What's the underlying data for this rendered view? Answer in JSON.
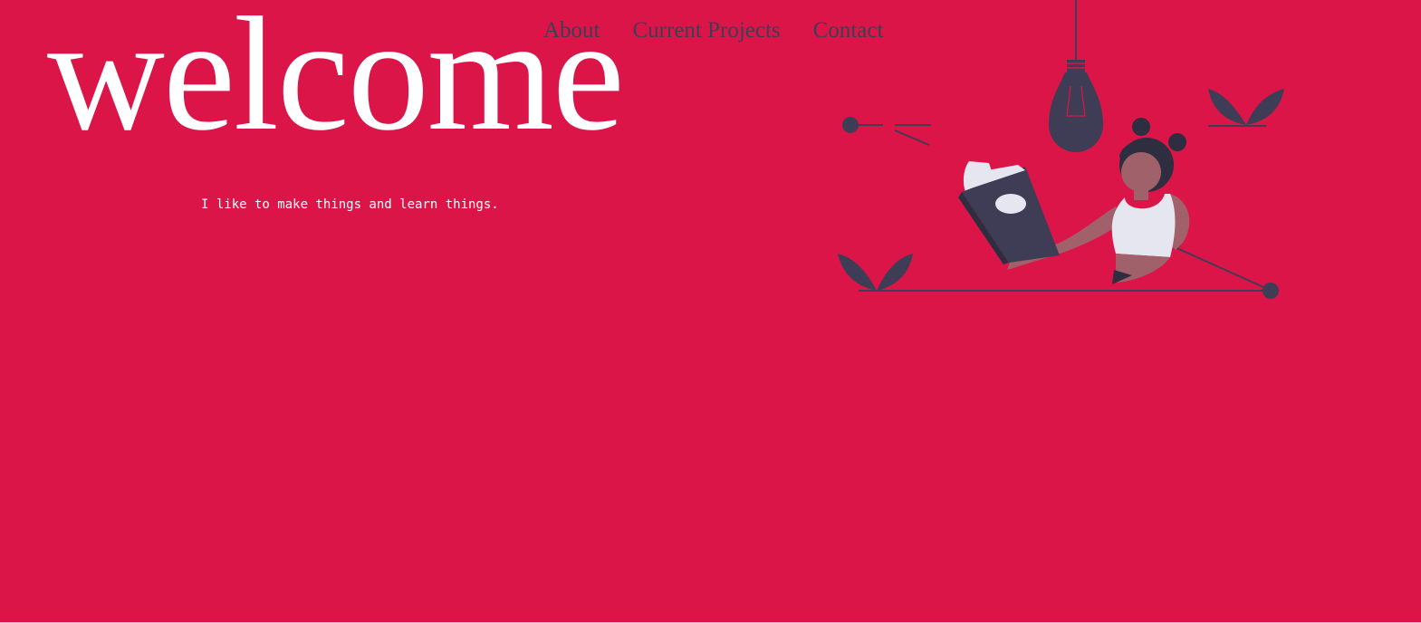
{
  "nav": {
    "items": [
      {
        "label": "About"
      },
      {
        "label": "Current Projects"
      },
      {
        "label": "Contact"
      }
    ]
  },
  "hero": {
    "title": "welcome",
    "tagline": "I like to make things and learn things."
  },
  "illustration": {
    "icon": "person-reading-book-illustration",
    "colors": {
      "background": "#dc1549",
      "dark": "#3f3d56",
      "skin": "#a0616a",
      "light": "#e6e6f0"
    }
  }
}
